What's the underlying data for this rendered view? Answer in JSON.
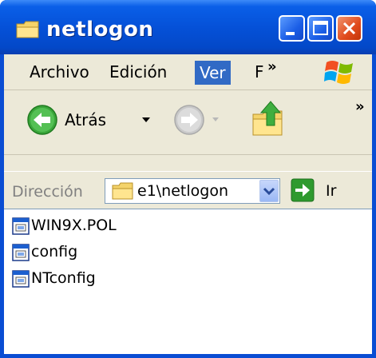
{
  "window": {
    "title": "netlogon",
    "controls": {
      "minimize": "minimize",
      "maximize": "maximize",
      "close": "close"
    }
  },
  "menubar": {
    "items": [
      {
        "label": "Archivo"
      },
      {
        "label": "Edición"
      },
      {
        "label": "Ver",
        "active": true
      },
      {
        "label": "F"
      }
    ],
    "overflow": "»"
  },
  "toolbar": {
    "back_label": "Atrás",
    "overflow": "»"
  },
  "address": {
    "label": "Dirección",
    "value": "e1\\netlogon",
    "go_label": "Ir"
  },
  "files": [
    {
      "name": "WIN9X.POL"
    },
    {
      "name": "config"
    },
    {
      "name": "NTconfig"
    }
  ],
  "colors": {
    "titlebar": "#0551d8",
    "menu_highlight": "#316ac5",
    "close_button": "#e04a1c",
    "go_arrow": "#2e9a2e"
  }
}
